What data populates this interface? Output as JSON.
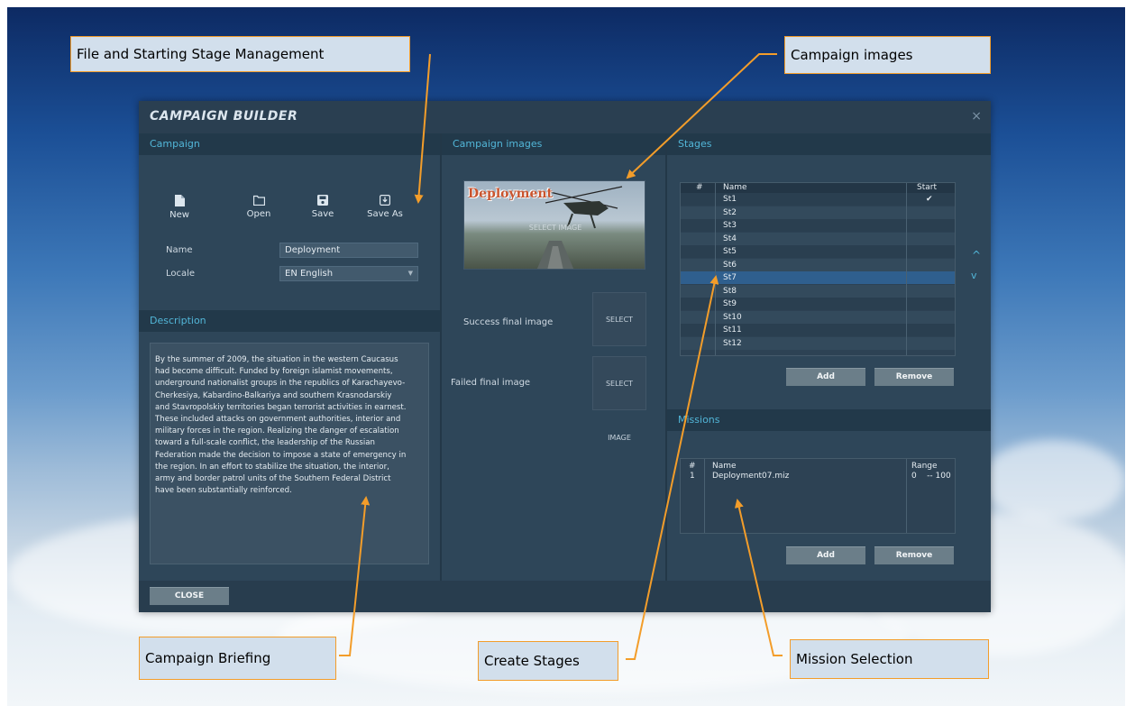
{
  "window": {
    "title": "CAMPAIGN BUILDER",
    "close_glyph": "×"
  },
  "campaign": {
    "header": "Campaign",
    "tools": [
      {
        "label": "New",
        "icon": "new-file-icon"
      },
      {
        "label": "Open",
        "icon": "folder-icon"
      },
      {
        "label": "Save",
        "icon": "save-icon"
      },
      {
        "label": "Save As",
        "icon": "save-as-icon"
      }
    ],
    "name_label": "Name",
    "name_value": "Deployment",
    "locale_label": "Locale",
    "locale_value": "EN English"
  },
  "description": {
    "header": "Description",
    "text": "By the summer of 2009, the situation in the western Caucasus\nhad become difficult. Funded by foreign islamist movements,\nunderground nationalist groups in the republics of Karachayevo-\nCherkesiya, Kabardino-Balkariya and southern Krasnodarskiy\nand Stavropolskiy territories began terrorist activities in earnest.\n These included attacks on government authorities, interior and\nmilitary forces in the region. Realizing the danger of escalation\ntoward a full-scale conflict, the leadership of the Russian\nFederation made the decision to impose a state of emergency in\nthe region. In an effort to stabilize the situation, the interior,\narmy and border patrol units of the Southern Federal District\nhave been substantially reinforced."
  },
  "images": {
    "header": "Campaign images",
    "main_logo": "Deployment",
    "main_select": "SELECT IMAGE",
    "success_label": "Success final image",
    "success_select": "SELECT IMAGE",
    "failed_label": "Failed final image",
    "failed_select": "SELECT IMAGE"
  },
  "stages": {
    "header": "Stages",
    "columns": [
      "#",
      "Name",
      "Start"
    ],
    "rows": [
      {
        "name": "St1",
        "start": "✔"
      },
      {
        "name": "St2",
        "start": ""
      },
      {
        "name": "St3",
        "start": ""
      },
      {
        "name": "St4",
        "start": ""
      },
      {
        "name": "St5",
        "start": ""
      },
      {
        "name": "St6",
        "start": ""
      },
      {
        "name": "St7",
        "start": ""
      },
      {
        "name": "St8",
        "start": ""
      },
      {
        "name": "St9",
        "start": ""
      },
      {
        "name": "St10",
        "start": ""
      },
      {
        "name": "St11",
        "start": ""
      },
      {
        "name": "St12",
        "start": ""
      }
    ],
    "selected_row": "St7",
    "add_label": "Add",
    "remove_label": "Remove",
    "up_glyph": "^",
    "down_glyph": "v"
  },
  "missions": {
    "header": "Missions",
    "columns": [
      "#",
      "Name",
      "Range"
    ],
    "rows": [
      {
        "num": "1",
        "name": "Deployment07.miz",
        "range": "0    -- 100"
      }
    ],
    "add_label": "Add",
    "remove_label": "Remove"
  },
  "footer": {
    "close_label": "CLOSE"
  },
  "callouts": {
    "file": "File and Starting Stage Management",
    "images": "Campaign images",
    "briefing": "Campaign Briefing",
    "stages": "Create Stages",
    "missions": "Mission Selection"
  },
  "colors": {
    "accent_header": "#52b6d8",
    "callout_border": "#f39d2a",
    "arrow": "#f39d2a",
    "selected_row": "#2f5f8e"
  }
}
